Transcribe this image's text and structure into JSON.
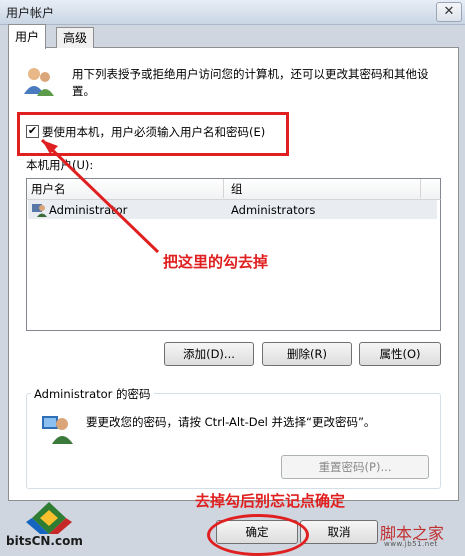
{
  "window": {
    "title": "用户帐户",
    "close_glyph": "✕"
  },
  "tabs": [
    {
      "label": "用户"
    },
    {
      "label": "高级"
    }
  ],
  "intro": {
    "text": "用下列表授予或拒绝用户访问您的计算机，还可以更改其密码和其他设置。"
  },
  "checkbox": {
    "label": "要使用本机，用户必须输入用户名和密码(E)",
    "checked": true,
    "check_glyph": "✔"
  },
  "local_users": {
    "label": "本机用户(U):",
    "columns": [
      "用户名",
      "组"
    ],
    "rows": [
      {
        "user": "Administrator",
        "group": "Administrators"
      }
    ]
  },
  "buttons": {
    "add": "添加(D)...",
    "remove": "删除(R)",
    "properties": "属性(O)"
  },
  "password_group": {
    "title": "Administrator 的密码",
    "text": "要更改您的密码，请按 Ctrl-Alt-Del 并选择“更改密码”。",
    "reset": "重置密码(P)..."
  },
  "dialog": {
    "ok": "确定",
    "cancel": "取消"
  },
  "annotations": {
    "arrow_note": "把这里的勾去掉",
    "ok_note": "去掉勾后别忘记点确定"
  },
  "watermarks": {
    "left": "bitsCN.com",
    "right": "脚本之家",
    "right_sub": "www.jb51.net"
  },
  "colors": {
    "annotation": "#e02020",
    "selected_row": "#e9edf2"
  }
}
